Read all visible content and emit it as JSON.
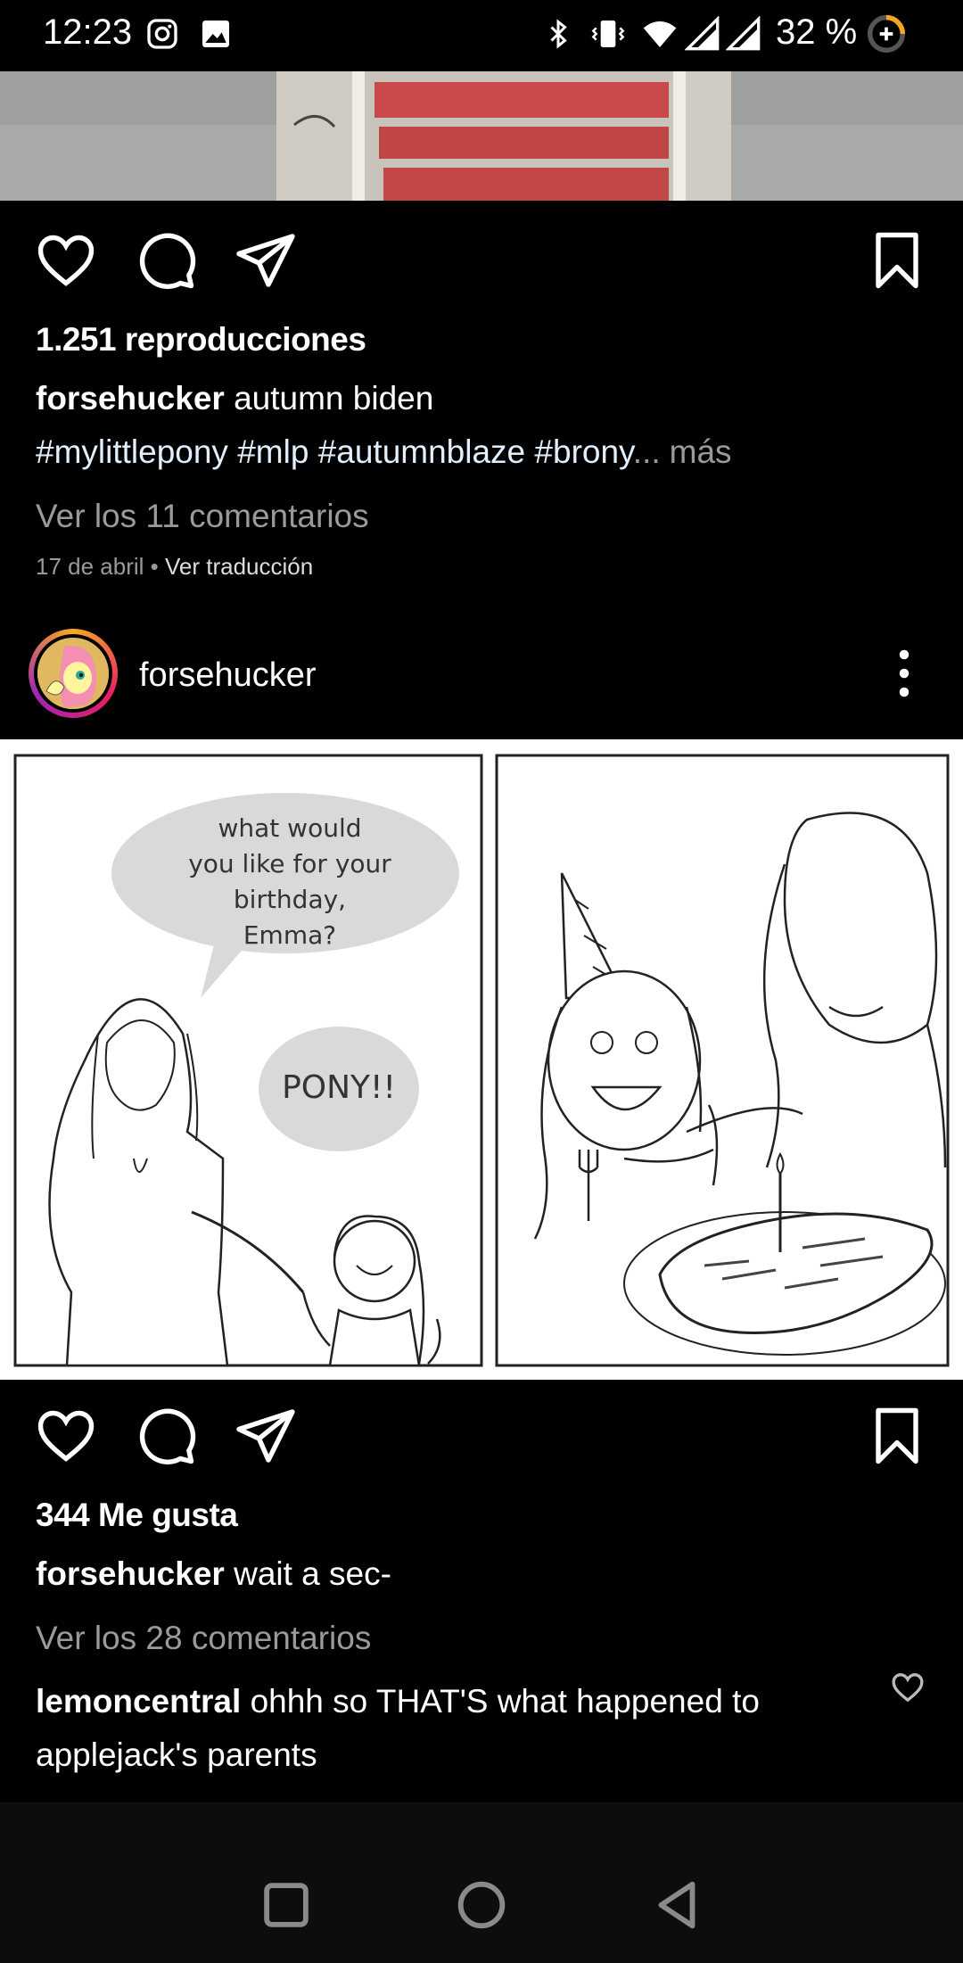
{
  "status_bar": {
    "time": "12:23",
    "battery": "32 %",
    "icons": [
      "instagram-icon",
      "gallery-icon",
      "bluetooth-icon",
      "vibrate-icon",
      "wifi-icon",
      "signal-icon",
      "signal-icon",
      "battery-saver-icon"
    ]
  },
  "post1": {
    "views": "1.251 reproducciones",
    "username": "forsehucker",
    "caption": "autumn biden",
    "hashtags": "#mylittlepony #mlp #autumnblaze #brony",
    "ellipsis": "...",
    "more": "más",
    "view_comments": "Ver los 11 comentarios",
    "date": "17 de abril",
    "separator": " • ",
    "translate": "Ver traducción"
  },
  "post2": {
    "username": "forsehucker",
    "comic": {
      "bubble1": [
        "what would",
        "you like for your",
        "birthday,",
        "Emma?"
      ],
      "bubble2": "PONY!!"
    },
    "likes": "344 Me gusta",
    "caption_user": "forsehucker",
    "caption": "wait a sec-",
    "view_comments": "Ver los 28 comentarios",
    "comments": [
      {
        "user": "lemoncentral",
        "text_line1": "ohhh so THAT'S what happened to",
        "text_line2": "applejack's parents"
      }
    ]
  },
  "colors": {
    "background": "#000000",
    "muted_text": "#9a9a9a",
    "nav_bar": "#0d0d0d"
  }
}
